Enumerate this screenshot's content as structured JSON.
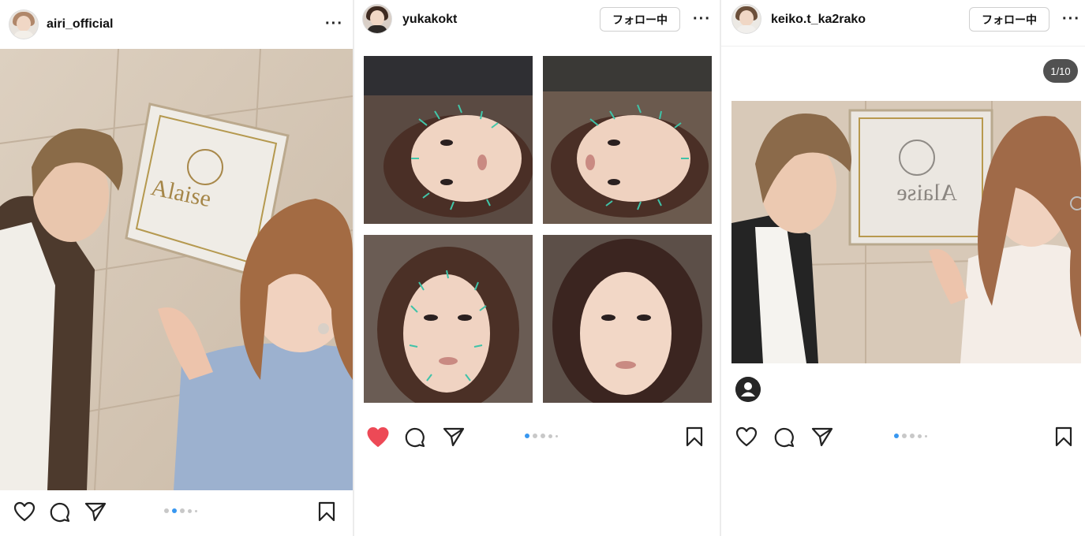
{
  "posts": [
    {
      "username": "airi_official",
      "more_label": "···",
      "carousel": {
        "count": 5,
        "active": 2
      }
    },
    {
      "username": "yukakokt",
      "follow_label": "フォロー中",
      "more_label": "···",
      "liked": true,
      "carousel": {
        "count": 5,
        "active": 1
      }
    },
    {
      "username": "keiko.t_ka2rako",
      "follow_label": "フォロー中",
      "more_label": "···",
      "photo_counter": "1/10",
      "carousel": {
        "count": 5,
        "active": 1
      }
    }
  ],
  "colors": {
    "like_active": "#ed4956",
    "carousel_active": "#3897f0",
    "carousel_inactive": "#c8c8c8"
  },
  "icons": [
    "heart-icon",
    "comment-icon",
    "share-icon",
    "bookmark-icon",
    "more-icon",
    "user-tag-icon"
  ]
}
